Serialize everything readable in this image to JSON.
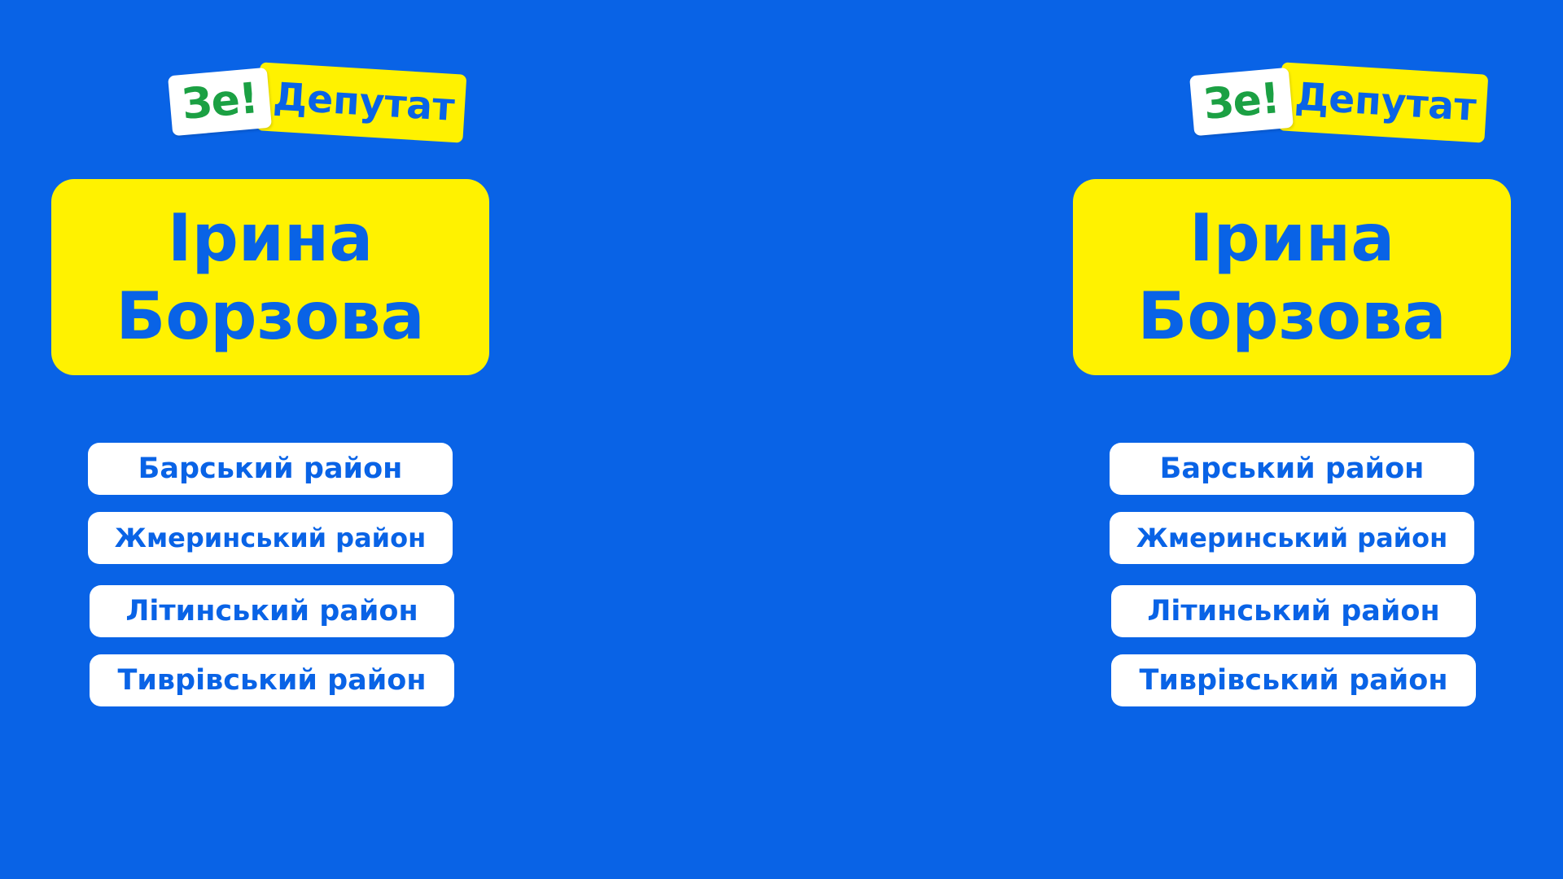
{
  "logo": {
    "ze": "Зе!",
    "deputat": "Депутат"
  },
  "candidate": {
    "first_name": "Ірина",
    "last_name": "Борзова"
  },
  "districts": [
    "Барський район",
    "Жмеринський район",
    "Літинський район",
    "Тиврівський район"
  ],
  "colors": {
    "background": "#0963e6",
    "accent_yellow": "#fff200",
    "brand_green": "#1ba043",
    "white": "#ffffff"
  }
}
